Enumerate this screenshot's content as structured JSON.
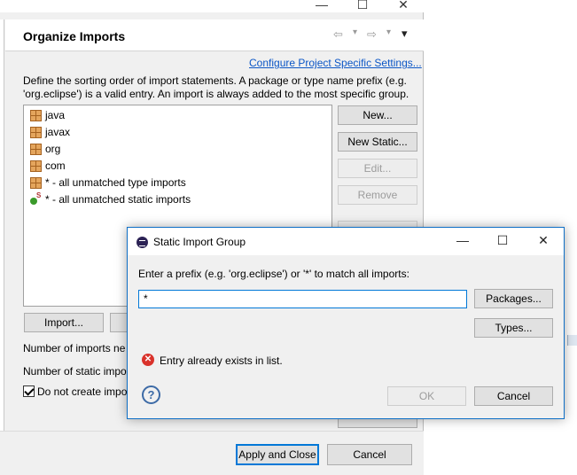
{
  "prefs_window": {
    "caption_minimize": "—",
    "caption_maximize": "☐",
    "caption_close": "✕",
    "page_title": "Organize Imports",
    "nav_back_glyph": "⇦",
    "nav_forward_glyph": "⇨",
    "nav_menu_glyph": "▾",
    "configure_link": "Configure Project Specific Settings...",
    "description_line1": "Define the sorting order of import statements. A package or type name prefix (e.g.",
    "description_line2": "'org.eclipse') is a valid entry. An import is always added to the most specific group.",
    "import_order": [
      {
        "label": "java",
        "icon": "package-icon"
      },
      {
        "label": "javax",
        "icon": "package-icon"
      },
      {
        "label": "org",
        "icon": "package-icon"
      },
      {
        "label": "com",
        "icon": "package-icon"
      },
      {
        "label": "* - all unmatched type imports",
        "icon": "package-icon"
      },
      {
        "label": "* - all unmatched static imports",
        "icon": "static-import-icon"
      }
    ],
    "buttons": {
      "new": "New...",
      "new_static": "New Static...",
      "edit": "Edit...",
      "remove": "Remove",
      "import": "Import...",
      "apply_and_close": "Apply and Close",
      "cancel": "Cancel"
    },
    "num_imports_label": "Number of imports ne",
    "num_static_label": "Number of static impo",
    "do_not_create_label": "Do not create impo",
    "do_not_create_checked": true
  },
  "dialog": {
    "title": "Static Import Group",
    "caption_minimize": "—",
    "caption_maximize": "☐",
    "caption_close": "✕",
    "prompt": "Enter a prefix (e.g. 'org.eclipse') or '*' to match all imports:",
    "prefix_value": "*",
    "error_icon_glyph": "✕",
    "error_message": "Entry already exists in list.",
    "help_glyph": "?",
    "buttons": {
      "packages": "Packages...",
      "types": "Types...",
      "ok": "OK",
      "cancel": "Cancel"
    }
  },
  "colors": {
    "link": "#0b56c6",
    "focus_border": "#0078d7",
    "dialog_border": "#0f6fc6",
    "error": "#d9322b"
  }
}
